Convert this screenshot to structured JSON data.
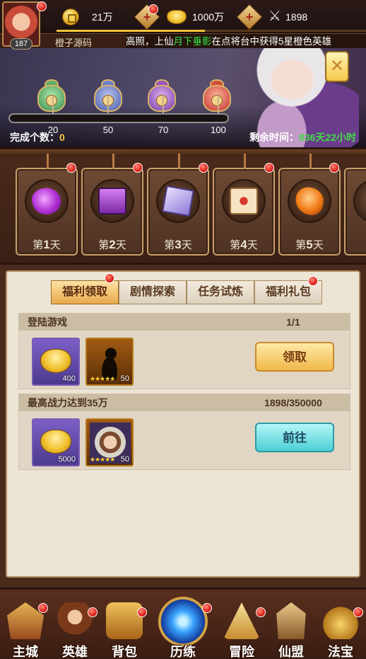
{
  "player": {
    "level": "187",
    "name": "橙子源码"
  },
  "resources": {
    "coins": "21万",
    "ingots": "1000万",
    "power": "1898"
  },
  "notice": {
    "prefix": "高照，上仙",
    "highlight": "月下垂影",
    "suffix": "在点将台中获得5星橙色英雄"
  },
  "milestones": {
    "values": [
      "20",
      "50",
      "70",
      "100"
    ],
    "progress": 0
  },
  "event": {
    "completed_label": "完成个数：",
    "completed_value": "0",
    "remaining_label": "剩余时间：",
    "remaining_value": "836天22小时"
  },
  "days": [
    {
      "prefix": "第",
      "num": "1",
      "suffix": "天",
      "icon": "purple-crystal-icon"
    },
    {
      "prefix": "第",
      "num": "2",
      "suffix": "天",
      "icon": "purple-chest-icon"
    },
    {
      "prefix": "第",
      "num": "3",
      "suffix": "天",
      "icon": "scroll-book-icon"
    },
    {
      "prefix": "第",
      "num": "4",
      "suffix": "天",
      "icon": "red-box-icon"
    },
    {
      "prefix": "第",
      "num": "5",
      "suffix": "天",
      "icon": "orange-crystal-icon"
    }
  ],
  "tabs": [
    "福利领取",
    "剧情探索",
    "任务试炼",
    "福利礼包"
  ],
  "tasks": [
    {
      "title": "登陆游戏",
      "progress": "1/1",
      "rewards": [
        {
          "icon": "gold-ingot-icon",
          "qty": "400"
        },
        {
          "icon": "hero-silhouette-icon",
          "qty": "50"
        }
      ],
      "button": "领取"
    },
    {
      "title": "最高战力达到35万",
      "progress": "1898/350000",
      "rewards": [
        {
          "icon": "gold-ingot-icon",
          "qty": "5000"
        },
        {
          "icon": "hero-portrait-icon",
          "qty": "50"
        }
      ],
      "button": "前往"
    }
  ],
  "nav": [
    "主城",
    "英雄",
    "背包",
    "历练",
    "冒险",
    "仙盟",
    "法宝"
  ]
}
